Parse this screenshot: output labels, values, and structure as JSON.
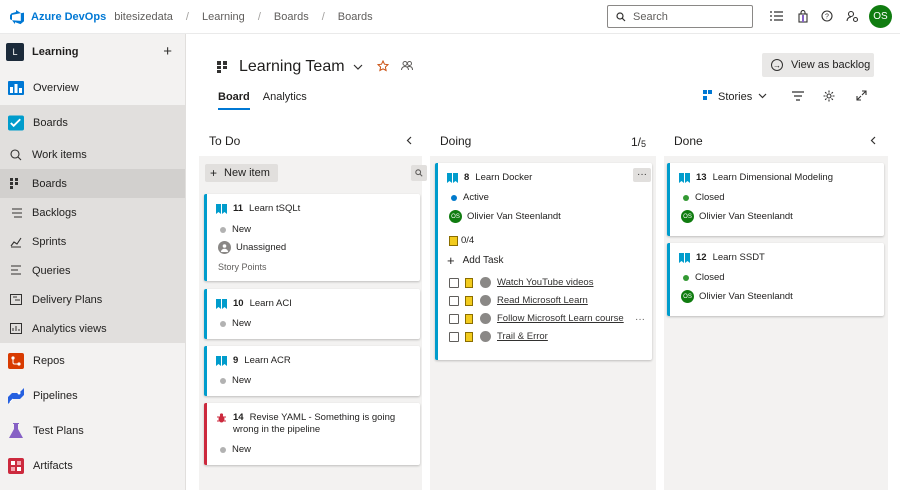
{
  "topbar": {
    "brand": "Azure DevOps",
    "breadcrumbs": [
      "bitesizedata",
      "Learning",
      "Boards",
      "Boards"
    ],
    "search_placeholder": "Search",
    "icons": [
      "search-icon",
      "task-list-icon",
      "shopping-bag-icon",
      "help-icon",
      "user-settings-icon"
    ],
    "user_initials": "OS"
  },
  "sidebar": {
    "project_initial": "L",
    "project_name": "Learning",
    "add_icon": "plus-icon",
    "items": [
      {
        "label": "Overview",
        "icon": "overview-icon",
        "color": "#0078d4"
      },
      {
        "label": "Boards",
        "icon": "boards-icon",
        "color": "#009ccc"
      },
      {
        "label": "Work items",
        "icon": "work-items-icon"
      },
      {
        "label": "Boards",
        "icon": "board-icon"
      },
      {
        "label": "Backlogs",
        "icon": "backlogs-icon"
      },
      {
        "label": "Sprints",
        "icon": "sprints-icon"
      },
      {
        "label": "Queries",
        "icon": "queries-icon"
      },
      {
        "label": "Delivery Plans",
        "icon": "delivery-plans-icon"
      },
      {
        "label": "Analytics views",
        "icon": "analytics-icon"
      },
      {
        "label": "Repos",
        "icon": "repos-icon",
        "color": "#d83b01"
      },
      {
        "label": "Pipelines",
        "icon": "pipelines-icon",
        "color": "#2560e0"
      },
      {
        "label": "Test Plans",
        "icon": "test-plans-icon",
        "color": "#8661c5"
      },
      {
        "label": "Artifacts",
        "icon": "artifacts-icon",
        "color": "#cc293d"
      }
    ]
  },
  "header": {
    "team_name": "Learning Team",
    "view_as_backlog": "View as backlog",
    "tabs": [
      "Board",
      "Analytics"
    ],
    "backlog_level": "Stories"
  },
  "columns": {
    "todo": {
      "title": "To Do",
      "new_item": "New item"
    },
    "doing": {
      "title": "Doing",
      "count": "1",
      "limit": "5"
    },
    "done": {
      "title": "Done"
    }
  },
  "cards": {
    "todo": [
      {
        "id": "11",
        "title": "Learn tSQLt",
        "state": "New",
        "assignee": "Unassigned",
        "points_label": "Story Points",
        "type": "story"
      },
      {
        "id": "10",
        "title": "Learn ACI",
        "state": "New",
        "type": "story"
      },
      {
        "id": "9",
        "title": "Learn ACR",
        "state": "New",
        "type": "story"
      },
      {
        "id": "14",
        "title": "Revise YAML - Something is going wrong in the pipeline",
        "state": "New",
        "type": "bug"
      }
    ],
    "doing": [
      {
        "id": "8",
        "title": "Learn Docker",
        "state": "Active",
        "assignee": "Olivier Van Steenlandt",
        "assignee_initials": "OS",
        "task_progress": "0/4",
        "add_task": "Add Task",
        "tasks": [
          "Watch YouTube videos",
          "Read Microsoft Learn",
          "Follow Microsoft Learn course",
          "Trail & Error"
        ]
      }
    ],
    "done": [
      {
        "id": "13",
        "title": "Learn Dimensional Modeling",
        "state": "Closed",
        "assignee": "Olivier Van Steenlandt",
        "assignee_initials": "OS"
      },
      {
        "id": "12",
        "title": "Learn SSDT",
        "state": "Closed",
        "assignee": "Olivier Van Steenlandt",
        "assignee_initials": "OS"
      }
    ]
  },
  "colors": {
    "accent": "#0078d4",
    "story": "#009ccc",
    "bug": "#cc293d",
    "state_new": "#b2b2b2",
    "state_active": "#007acc",
    "state_closed": "#339933",
    "avatar": "#107c10"
  }
}
